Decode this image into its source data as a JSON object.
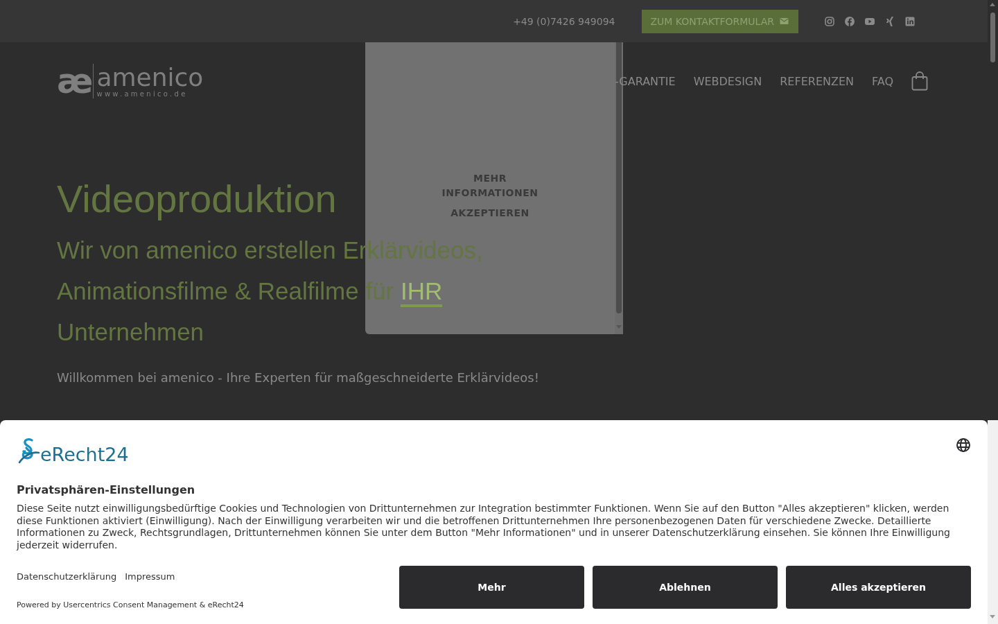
{
  "top_bar": {
    "phone": "+49 (0)7426 949094",
    "contact_button": "ZUM KONTAKTFORMULAR",
    "social": [
      {
        "kind": "instagram"
      },
      {
        "kind": "facebook"
      },
      {
        "kind": "youtube"
      },
      {
        "kind": "xing"
      },
      {
        "kind": "linkedin"
      }
    ]
  },
  "header": {
    "logo": {
      "mark": "æ",
      "name": "amenico",
      "url": "www.amenico.de"
    },
    "nav": [
      {
        "label": "-GARANTIE"
      },
      {
        "label": "WEBDESIGN"
      },
      {
        "label": "REFERENZEN"
      },
      {
        "label": "FAQ"
      }
    ]
  },
  "hero": {
    "title": "Videoproduktion",
    "subtitle": {
      "before": "Wir von amenico erstellen Erklärvideos, Animationsfilme & Realfilme für ",
      "link": "IHR",
      "after": " Unternehmen"
    },
    "intro": "Willkommen bei amenico - Ihre Experten für maßgeschneiderte Erklärvideos!"
  },
  "embed_popup": {
    "buttons": [
      "MEHR INFORMATIONEN",
      "AKZEPTIEREN"
    ]
  },
  "consent_banner": {
    "brand": "eRecht24",
    "title": "Privatsphären-Einstellungen",
    "text": "Diese Seite nutzt einwilligungsbedürftige Cookies und Technologien von Drittunternehmen zur Integration bestimmter Funktionen. Wenn Sie auf den Button \"Alles akzeptieren\" klicken, werden diese Funktionen aktiviert (Einwilligung). Nach der Einwilligung verarbeiten wir und die betroffenen Drittunternehmen Ihre personenbezogenen Daten für verschiedene Zwecke. Detaillierte Informationen zu Zweck, Rechtsgrundlagen, Drittunternehmen können Sie unter dem Button \"Mehr Informationen\" und in unserer Datenschutzerklärung einsehen. Sie können Ihre Einwilligung jederzeit widerrufen.",
    "links": [
      "Datenschutzerklärung",
      "Impressum"
    ],
    "powered_by": "Powered by Usercentrics Consent Management & eRecht24",
    "buttons": [
      "Mehr",
      "Ablehnen",
      "Alles akzeptieren"
    ]
  }
}
